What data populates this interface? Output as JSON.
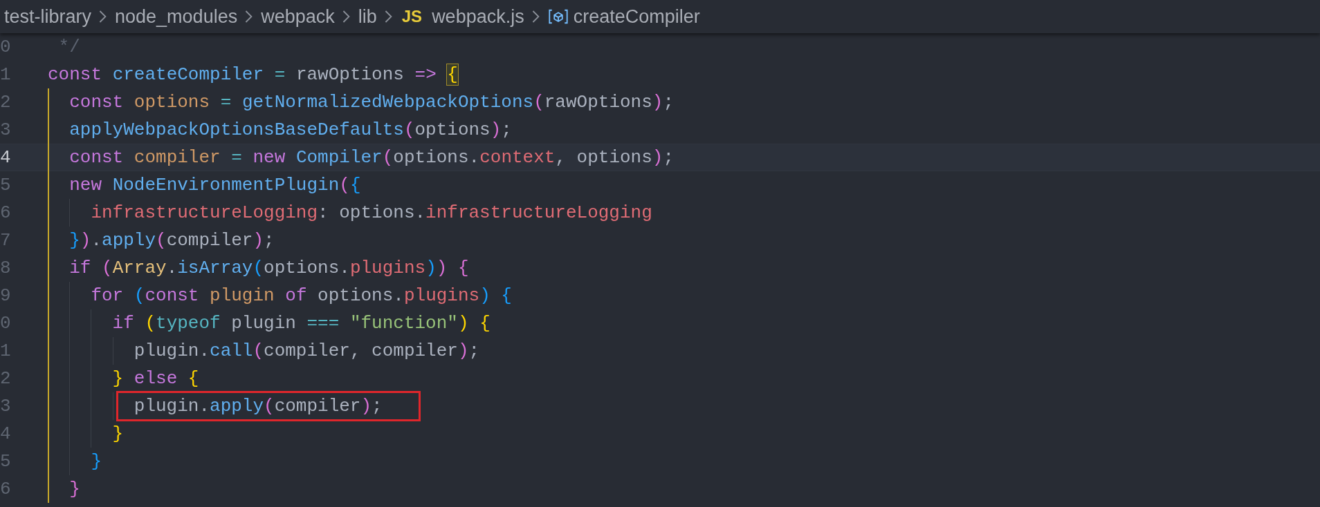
{
  "breadcrumb": [
    {
      "label": "test-library",
      "kind": "folder"
    },
    {
      "label": "node_modules",
      "kind": "folder"
    },
    {
      "label": "webpack",
      "kind": "folder"
    },
    {
      "label": "lib",
      "kind": "folder"
    },
    {
      "label": "webpack.js",
      "kind": "file",
      "badge": "JS"
    },
    {
      "label": "createCompiler",
      "kind": "symbol"
    }
  ],
  "lines": [
    {
      "number": "0",
      "current": false,
      "annotated": false,
      "tokens": [
        {
          "text": " */",
          "kind": "comment"
        }
      ]
    },
    {
      "number": "1",
      "current": false,
      "annotated": false,
      "tokens": [
        {
          "text": "const ",
          "kind": "keyword"
        },
        {
          "text": "createCompiler ",
          "kind": "function"
        },
        {
          "text": "= ",
          "kind": "operator"
        },
        {
          "text": "rawOptions ",
          "kind": "plain"
        },
        {
          "text": "=> ",
          "kind": "keyword"
        },
        {
          "text": "{",
          "kind": "bracket-match"
        }
      ]
    },
    {
      "number": "2",
      "current": false,
      "annotated": false,
      "tokens": [
        {
          "text": "  const ",
          "kind": "keyword"
        },
        {
          "text": "options ",
          "kind": "variable"
        },
        {
          "text": "= ",
          "kind": "operator"
        },
        {
          "text": "getNormalizedWebpackOptions",
          "kind": "function"
        },
        {
          "text": "(",
          "kind": "bracket2"
        },
        {
          "text": "rawOptions",
          "kind": "plain"
        },
        {
          "text": ")",
          "kind": "bracket2"
        },
        {
          "text": ";",
          "kind": "plain"
        }
      ]
    },
    {
      "number": "3",
      "current": false,
      "annotated": false,
      "tokens": [
        {
          "text": "  applyWebpackOptionsBaseDefaults",
          "kind": "function"
        },
        {
          "text": "(",
          "kind": "bracket2"
        },
        {
          "text": "options",
          "kind": "plain"
        },
        {
          "text": ")",
          "kind": "bracket2"
        },
        {
          "text": ";",
          "kind": "plain"
        }
      ]
    },
    {
      "number": "4",
      "current": true,
      "annotated": false,
      "tokens": [
        {
          "text": "  const ",
          "kind": "keyword"
        },
        {
          "text": "compiler ",
          "kind": "variable"
        },
        {
          "text": "= ",
          "kind": "operator"
        },
        {
          "text": "new ",
          "kind": "keyword"
        },
        {
          "text": "Compiler",
          "kind": "function"
        },
        {
          "text": "(",
          "kind": "bracket2"
        },
        {
          "text": "options.",
          "kind": "plain"
        },
        {
          "text": "context",
          "kind": "property"
        },
        {
          "text": ", options",
          "kind": "plain"
        },
        {
          "text": ")",
          "kind": "bracket2"
        },
        {
          "text": ";",
          "kind": "plain"
        }
      ]
    },
    {
      "number": "5",
      "current": false,
      "annotated": false,
      "tokens": [
        {
          "text": "  new ",
          "kind": "keyword"
        },
        {
          "text": "NodeEnvironmentPlugin",
          "kind": "function"
        },
        {
          "text": "(",
          "kind": "bracket2"
        },
        {
          "text": "{",
          "kind": "bracket3"
        }
      ]
    },
    {
      "number": "6",
      "current": false,
      "annotated": false,
      "tokens": [
        {
          "text": "    infrastructureLogging",
          "kind": "property"
        },
        {
          "text": ": options.",
          "kind": "plain"
        },
        {
          "text": "infrastructureLogging",
          "kind": "property"
        }
      ]
    },
    {
      "number": "7",
      "current": false,
      "annotated": false,
      "tokens": [
        {
          "text": "  }",
          "kind": "bracket3"
        },
        {
          "text": ")",
          "kind": "bracket2"
        },
        {
          "text": ".",
          "kind": "plain"
        },
        {
          "text": "apply",
          "kind": "function"
        },
        {
          "text": "(",
          "kind": "bracket2"
        },
        {
          "text": "compiler",
          "kind": "plain"
        },
        {
          "text": ")",
          "kind": "bracket2"
        },
        {
          "text": ";",
          "kind": "plain"
        }
      ]
    },
    {
      "number": "8",
      "current": false,
      "annotated": false,
      "tokens": [
        {
          "text": "  if ",
          "kind": "keyword"
        },
        {
          "text": "(",
          "kind": "bracket2"
        },
        {
          "text": "Array",
          "kind": "type"
        },
        {
          "text": ".",
          "kind": "plain"
        },
        {
          "text": "isArray",
          "kind": "function"
        },
        {
          "text": "(",
          "kind": "bracket3"
        },
        {
          "text": "options.",
          "kind": "plain"
        },
        {
          "text": "plugins",
          "kind": "property"
        },
        {
          "text": ")",
          "kind": "bracket3"
        },
        {
          "text": ") ",
          "kind": "bracket2"
        },
        {
          "text": "{",
          "kind": "bracket2"
        }
      ]
    },
    {
      "number": "9",
      "current": false,
      "annotated": false,
      "tokens": [
        {
          "text": "    for ",
          "kind": "keyword"
        },
        {
          "text": "(",
          "kind": "bracket3"
        },
        {
          "text": "const ",
          "kind": "keyword"
        },
        {
          "text": "plugin ",
          "kind": "variable"
        },
        {
          "text": "of ",
          "kind": "keyword"
        },
        {
          "text": "options.",
          "kind": "plain"
        },
        {
          "text": "plugins",
          "kind": "property"
        },
        {
          "text": ") ",
          "kind": "bracket3"
        },
        {
          "text": "{",
          "kind": "bracket3"
        }
      ]
    },
    {
      "number": "0",
      "current": false,
      "annotated": false,
      "tokens": [
        {
          "text": "      if ",
          "kind": "keyword"
        },
        {
          "text": "(",
          "kind": "bracket1"
        },
        {
          "text": "typeof",
          "kind": "operator"
        },
        {
          "text": " plugin ",
          "kind": "plain"
        },
        {
          "text": "=== ",
          "kind": "operator"
        },
        {
          "text": "\"function\"",
          "kind": "string"
        },
        {
          "text": ") ",
          "kind": "bracket1"
        },
        {
          "text": "{",
          "kind": "bracket1"
        }
      ]
    },
    {
      "number": "1",
      "current": false,
      "annotated": false,
      "tokens": [
        {
          "text": "        plugin.",
          "kind": "plain"
        },
        {
          "text": "call",
          "kind": "function"
        },
        {
          "text": "(",
          "kind": "bracket2"
        },
        {
          "text": "compiler, compiler",
          "kind": "plain"
        },
        {
          "text": ")",
          "kind": "bracket2"
        },
        {
          "text": ";",
          "kind": "plain"
        }
      ]
    },
    {
      "number": "2",
      "current": false,
      "annotated": false,
      "tokens": [
        {
          "text": "      } ",
          "kind": "bracket1"
        },
        {
          "text": "else ",
          "kind": "keyword"
        },
        {
          "text": "{",
          "kind": "bracket1"
        }
      ]
    },
    {
      "number": "3",
      "current": false,
      "annotated": true,
      "tokens": [
        {
          "text": "        plugin.",
          "kind": "plain"
        },
        {
          "text": "apply",
          "kind": "function"
        },
        {
          "text": "(",
          "kind": "bracket2"
        },
        {
          "text": "compiler",
          "kind": "plain"
        },
        {
          "text": ")",
          "kind": "bracket2"
        },
        {
          "text": ";",
          "kind": "plain"
        }
      ]
    },
    {
      "number": "4",
      "current": false,
      "annotated": false,
      "tokens": [
        {
          "text": "      }",
          "kind": "bracket1"
        }
      ]
    },
    {
      "number": "5",
      "current": false,
      "annotated": false,
      "tokens": [
        {
          "text": "    }",
          "kind": "bracket3"
        }
      ]
    },
    {
      "number": "6",
      "current": false,
      "annotated": false,
      "tokens": [
        {
          "text": "  }",
          "kind": "bracket2"
        }
      ]
    }
  ]
}
